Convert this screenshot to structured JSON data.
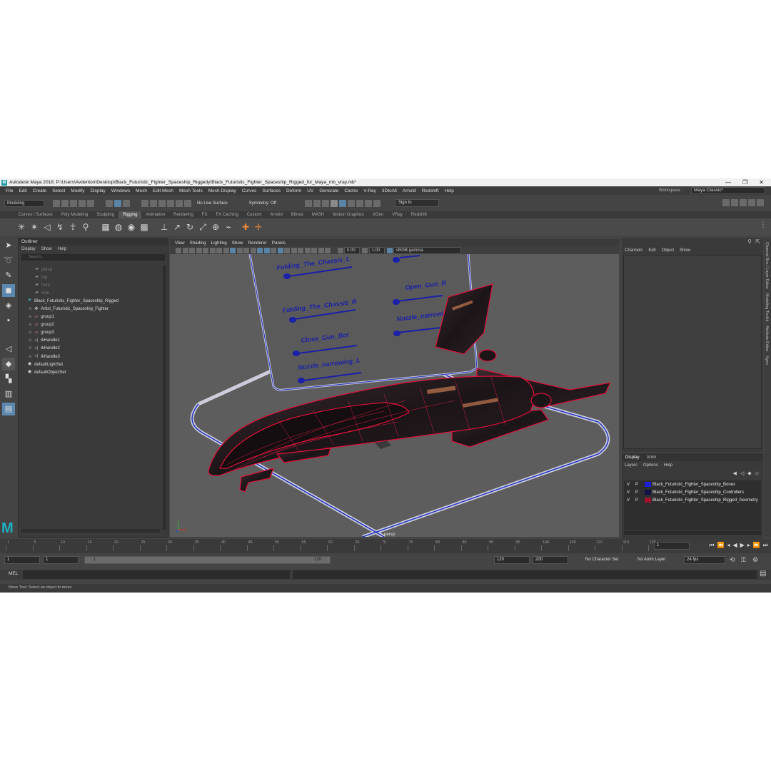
{
  "window": {
    "title": "Autodesk Maya 2018: P:\\Users\\Avdenton\\Desktop\\Black_Futuristic_Fighter_Spaceship_Riggedy\\Black_Futuristic_Fighter_Spaceship_Rigged_for_Maya_mb_vray.mb*",
    "logo_letter": "M",
    "controls": [
      "—",
      "❐",
      "✕"
    ]
  },
  "menubar": {
    "items": [
      "File",
      "Edit",
      "Create",
      "Select",
      "Modify",
      "Display",
      "Windows",
      "Mesh",
      "Edit Mesh",
      "Mesh Tools",
      "Mesh Display",
      "Curves",
      "Surfaces",
      "Deform",
      "UV",
      "Generate",
      "Cache",
      "V-Ray",
      "3DtoAll",
      "Arnold",
      "Redshift",
      "Help"
    ],
    "workspace_label": "Workspace :",
    "workspace_value": "Maya Classic*"
  },
  "statusline": {
    "mode": "Modeling",
    "live_surface": "No Live Surface",
    "symmetry": "Symmetry: Off",
    "sign_in": "Sign In"
  },
  "shelf": {
    "tabs": [
      "Curves / Surfaces",
      "Poly Modeling",
      "Sculpting",
      "Rigging",
      "Animation",
      "Rendering",
      "FX",
      "FX Caching",
      "Custom",
      "Arnold",
      "Bifrost",
      "MASH",
      "Motion Graphics",
      "XGen",
      "VRay",
      "Redshift"
    ],
    "active_tab": "Rigging"
  },
  "outliner": {
    "title": "Outliner",
    "menus": [
      "Display",
      "Show",
      "Help"
    ],
    "search_placeholder": "Search...",
    "items": [
      {
        "label": "persp",
        "dim": true,
        "icon": "camera-icon",
        "indent": 1
      },
      {
        "label": "top",
        "dim": true,
        "icon": "camera-icon",
        "indent": 1
      },
      {
        "label": "front",
        "dim": true,
        "icon": "camera-icon",
        "indent": 1
      },
      {
        "label": "side",
        "dim": true,
        "icon": "camera-icon",
        "indent": 1
      },
      {
        "label": "Black_Futuristic_Fighter_Spaceship_Rigged",
        "dim": false,
        "icon": "joint-icon",
        "indent": 0
      },
      {
        "label": "Artist_Futuristic_Spaceship_Fighter",
        "dim": false,
        "icon": "transform-icon",
        "indent": 1
      },
      {
        "label": "group1",
        "dim": false,
        "icon": "group-icon",
        "indent": 1
      },
      {
        "label": "group2",
        "dim": false,
        "icon": "group-icon",
        "indent": 1
      },
      {
        "label": "group3",
        "dim": false,
        "icon": "group-icon",
        "indent": 1
      },
      {
        "label": "ikHandle1",
        "dim": false,
        "icon": "ik-handle-icon",
        "indent": 1
      },
      {
        "label": "ikHandle2",
        "dim": false,
        "icon": "ik-handle-icon",
        "indent": 1
      },
      {
        "label": "ikHandle3",
        "dim": false,
        "icon": "ik-handle-icon",
        "indent": 1
      },
      {
        "label": "defaultLightSet",
        "dim": false,
        "icon": "set-icon",
        "indent": 0
      },
      {
        "label": "defaultObjectSet",
        "dim": false,
        "icon": "set-icon",
        "indent": 0
      }
    ]
  },
  "viewport": {
    "menus": [
      "View",
      "Shading",
      "Lighting",
      "Show",
      "Renderer",
      "Panels"
    ],
    "exposure": "0.00",
    "gamma": "1.00",
    "color_space": "sRGB gamma",
    "camera_label": "persp",
    "controller_labels": [
      "Folding_The_Chassis_L",
      "Folding_The_Chassis_R",
      "Close_Gun_Bot",
      "Nozzle_narrowing_L",
      "Open_Gun_R",
      "Nozzle_narrowing_R"
    ]
  },
  "channelbox": {
    "menus": [
      "Channels",
      "Edit",
      "Object",
      "Show"
    ]
  },
  "layers": {
    "tabs": [
      "Display",
      "Anim"
    ],
    "menus": [
      "Layers",
      "Options",
      "Help"
    ],
    "rows": [
      {
        "v": "V",
        "p": "P",
        "name": "Black_Futuristic_Fighter_Spaceship_Bones",
        "color": "#1f1fd8"
      },
      {
        "v": "V",
        "p": "P",
        "name": "Black_Futuristic_Fighter_Spaceship_Controllers",
        "color": "#12124a"
      },
      {
        "v": "V",
        "p": "P",
        "name": "Black_Futuristic_Fighter_Spaceship_Rigged_Geometry",
        "color": "#a0102a"
      }
    ]
  },
  "sidetabs": [
    "Channel Box / Layer Editor",
    "Modeling Toolkit",
    "Attribute Editor",
    "Xgen"
  ],
  "timeline": {
    "ticks": [
      "1",
      "5",
      "10",
      "15",
      "20",
      "25",
      "30",
      "35",
      "40",
      "45",
      "50",
      "55",
      "60",
      "65",
      "70",
      "75",
      "80",
      "85",
      "90",
      "95",
      "100",
      "105",
      "110",
      "115",
      "120"
    ],
    "current_frame": "1"
  },
  "range": {
    "start": "1",
    "playback_start": "1",
    "slider_start": "1",
    "slider_end": "120",
    "playback_end": "120",
    "end": "200",
    "character_set": "No Character Set",
    "anim_layer": "No Anim Layer",
    "fps": "24 fps"
  },
  "cmdline": {
    "label": "MEL"
  },
  "helpline": {
    "text": "Move Tool: Select an object to move."
  }
}
